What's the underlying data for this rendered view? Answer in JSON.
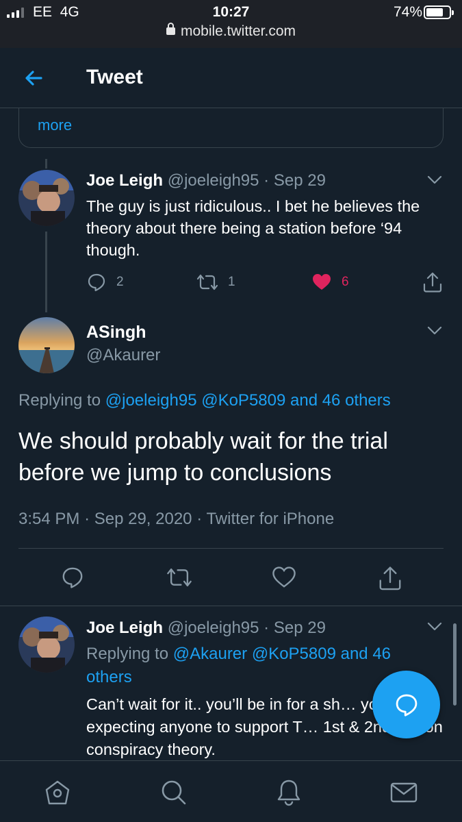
{
  "status_bar": {
    "carrier": "EE",
    "network": "4G",
    "time": "10:27",
    "battery_percent": "74%",
    "url": "mobile.twitter.com"
  },
  "header": {
    "title": "Tweet",
    "back_icon": "arrow-left-icon"
  },
  "quoted_card": {
    "more_label": "more"
  },
  "thread_reply": {
    "name": "Joe Leigh",
    "handle": "@joeleigh95",
    "separator": "·",
    "date": "Sep 29",
    "text": "The guy is just ridiculous.. I bet he believes the theory about there being a station before ‘94 though.",
    "reply_count": "2",
    "retweet_count": "1",
    "like_count": "6",
    "liked": true
  },
  "main_tweet": {
    "name": "ASingh",
    "handle": "@Akaurer",
    "replying_prefix": "Replying to",
    "replying_mentions": "@joeleigh95 @KoP5809 and 46 others",
    "text": "We should probably wait for the trial before we jump to conclusions",
    "time": "3:54 PM",
    "date": "Sep 29, 2020",
    "source": "Twitter for iPhone",
    "meta_sep": "·"
  },
  "second_reply": {
    "name": "Joe Leigh",
    "handle": "@joeleigh95",
    "separator": "·",
    "date": "Sep 29",
    "replying_prefix": "Replying to",
    "replying_mentions": "@Akaurer @KoP5809 and 46 others",
    "text": "Can’t wait for it.. you’ll be in for a sh… you’re expecting anyone to support T… 1st & 2nd station conspiracy theory."
  },
  "bottom_nav": [
    "home-icon",
    "search-icon",
    "notifications-icon",
    "messages-icon"
  ],
  "colors": {
    "background": "#15202b",
    "accent": "#1da1f2",
    "muted": "#8899a6",
    "like": "#e0245e",
    "border": "#38444d"
  }
}
